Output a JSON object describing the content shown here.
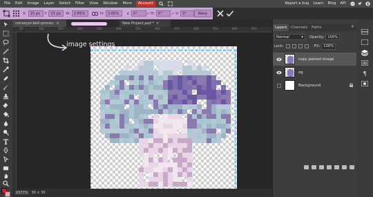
{
  "menubar": {
    "items": [
      "File",
      "Edit",
      "Image",
      "Layer",
      "Select",
      "Filter",
      "View",
      "Window",
      "More"
    ],
    "account": "Account",
    "right_items": [
      "Report a bug",
      "Learn",
      "Blog",
      "API"
    ]
  },
  "options": {
    "x_label": "X:",
    "x_value": "15 px",
    "y_label": "Y:",
    "y_value": "15 px",
    "w_label": "W:",
    "w_value": "2.65%",
    "h_label": "H:",
    "h_value": "2.65%",
    "a_value": "0°",
    "h2_label": "H:",
    "h2_value": "0°",
    "v_label": "V:",
    "v_value": "0°",
    "warp_label": "Warp"
  },
  "tabs": [
    {
      "label": "conveyor-belt-proces:",
      "close": "×"
    },
    {
      "label": "New Project.psd *",
      "close": "×"
    }
  ],
  "annotation": "image settings",
  "ruler_ticks": [
    "50",
    "100",
    "150",
    "200",
    "250",
    "300",
    "350",
    "400",
    "450",
    "500",
    "550",
    "600",
    "650"
  ],
  "status": {
    "zoom": "1577%",
    "size": "30 × 30"
  },
  "layers_panel": {
    "tabs": [
      "Layers",
      "Channels",
      "Paths"
    ],
    "close": "×",
    "blend_mode": "Normal",
    "opacity_label": "Opacity:",
    "opacity_value": "100%",
    "lock_label": "Lock:",
    "fill_label": "Fill:",
    "fill_value": "100%",
    "layers": [
      {
        "name": "copy pasted image"
      },
      {
        "name": "og"
      },
      {
        "name": "Background"
      }
    ]
  },
  "colors": {
    "accent_bar": "#cda6d8",
    "account_red": "#c4302b",
    "foreground": "#e8142a",
    "background_swatch": "#e7a7c1"
  }
}
